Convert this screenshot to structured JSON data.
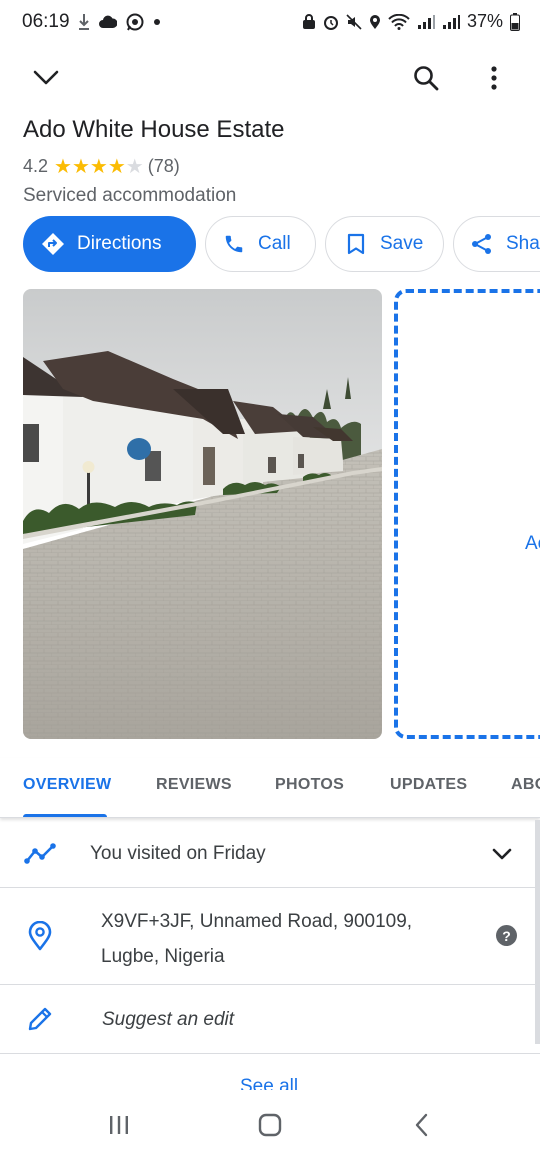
{
  "status_bar": {
    "time": "06:19",
    "battery": "37%"
  },
  "place": {
    "name": "Ado White House Estate",
    "rating": "4.2",
    "stars_filled": 4,
    "stars_total": 5,
    "review_count": "(78)",
    "category": "Serviced accommodation"
  },
  "actions": {
    "directions": "Directions",
    "call": "Call",
    "save": "Save",
    "share": "Sha"
  },
  "photos": {
    "add_label": "Ac"
  },
  "tabs": [
    {
      "label": "OVERVIEW",
      "active": true
    },
    {
      "label": "REVIEWS",
      "active": false
    },
    {
      "label": "PHOTOS",
      "active": false
    },
    {
      "label": "UPDATES",
      "active": false
    },
    {
      "label": "ABO",
      "active": false
    }
  ],
  "details": {
    "visited": "You visited on Friday",
    "address_line1": "X9VF+3JF, Unnamed Road, 900109,",
    "address_line2": "Lugbe, Nigeria",
    "help": "?",
    "suggest_edit": "Suggest an edit",
    "see_all": "See all"
  },
  "colors": {
    "accent": "#1a73e8",
    "star": "#fbbc04",
    "secondary_text": "#5f6368"
  }
}
